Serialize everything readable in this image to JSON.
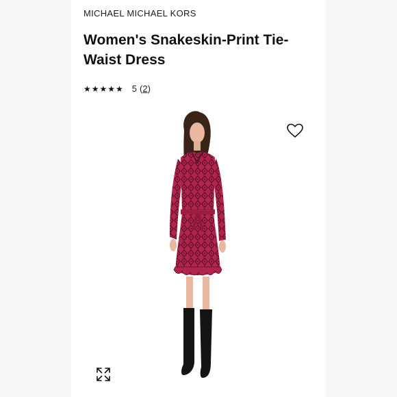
{
  "product": {
    "brand": "MICHAEL MICHAEL KORS",
    "title": "Women's Snakeskin-Print Tie-Waist Dress",
    "rating": {
      "stars_display": "★★★★★",
      "score": "5",
      "review_count": "2"
    }
  },
  "icons": {
    "wishlist": "heart-outline-icon",
    "expand": "expand-arrows-icon"
  },
  "colors": {
    "dress": "#b3244a",
    "dress_pattern": "#5e1230",
    "boots": "#141414",
    "hair": "#3a2418",
    "skin": "#e8b9a0"
  }
}
